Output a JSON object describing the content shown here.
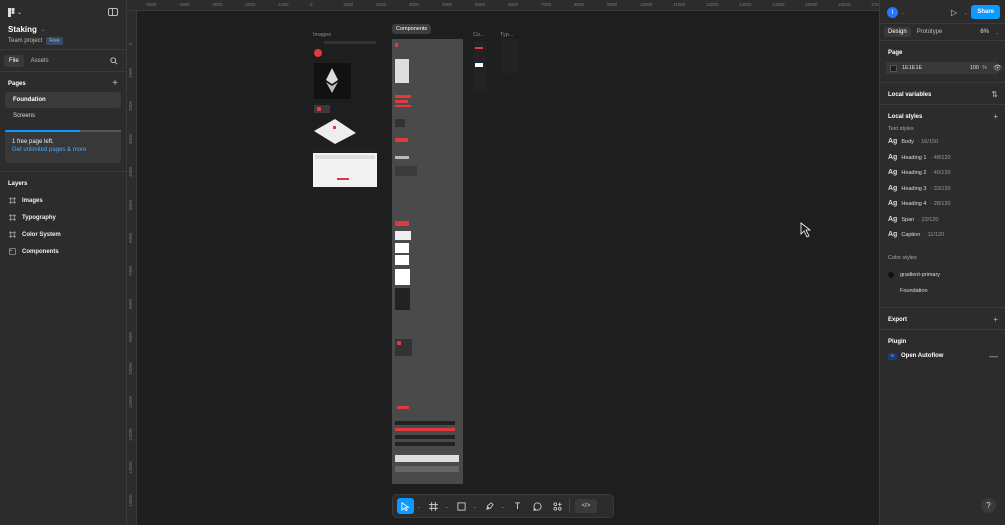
{
  "project": {
    "name": "Staking",
    "team": "Team project",
    "plan_badge": "Free"
  },
  "left_tabs": [
    "File",
    "Assets"
  ],
  "pages": {
    "title": "Pages",
    "items": [
      "Foundation",
      "Screens"
    ]
  },
  "promo": {
    "progress": 0.65,
    "line1": "1 free page left.",
    "line2": "Get unlimited pages & more"
  },
  "layers": {
    "title": "Layers",
    "items": [
      "Images",
      "Typography",
      "Color System",
      "Components"
    ]
  },
  "ruler_top": [
    "-5000",
    "-4000",
    "-3000",
    "-2000",
    "-1000",
    "0",
    "1000",
    "2000",
    "3000",
    "4000",
    "5000",
    "6000",
    "7000",
    "8000",
    "9000",
    "10000",
    "11000",
    "12000",
    "13000",
    "14000",
    "15000",
    "16000",
    "170"
  ],
  "ruler_left": [
    "0",
    "1000",
    "2000",
    "3000",
    "4000",
    "5000",
    "6000",
    "7000",
    "8000",
    "9000",
    "10000",
    "11000",
    "12000",
    "13000",
    "14000"
  ],
  "canvas_frames": {
    "images": "Images",
    "components": "Components",
    "co": "Co...",
    "typ": "Typ..."
  },
  "toolbar": {
    "icons": [
      "move-tool-icon",
      "frame-tool-icon",
      "rectangle-tool-icon",
      "pen-tool-icon",
      "text-tool-icon",
      "comment-tool-icon",
      "actions-icon",
      "dev-mode-icon"
    ],
    "text_glyph": "T",
    "code_glyph": "</>"
  },
  "right": {
    "avatar_letter": "I",
    "share_label": "Share",
    "tabs": [
      "Design",
      "Prototype"
    ],
    "zoom": "6%",
    "page": {
      "title": "Page",
      "hex": "1E1E1E",
      "opacity": "100",
      "pct": "%"
    },
    "local_variables": "Local variables",
    "local_styles": "Local styles",
    "text_styles_title": "Text styles",
    "text_styles": [
      {
        "ag": "Ag",
        "name": "Body",
        "meta": "· 16/150"
      },
      {
        "ag": "Ag",
        "name": "Heading 1",
        "meta": "· 48/120"
      },
      {
        "ag": "Ag",
        "name": "Heading 2",
        "meta": "· 40/120"
      },
      {
        "ag": "Ag",
        "name": "Heading 3",
        "meta": "· 33/120"
      },
      {
        "ag": "Ag",
        "name": "Heading 4",
        "meta": "· 28/120"
      },
      {
        "ag": "Ag",
        "name": "Span",
        "meta": "· 23/120"
      },
      {
        "ag": "Ag",
        "name": "Caption",
        "meta": "· 11/120"
      }
    ],
    "color_styles_title": "Color styles",
    "color_styles": [
      {
        "name": "gradient-primary",
        "color": "#111111"
      },
      {
        "name": "Foundation",
        "color": "#2c2c2c"
      }
    ],
    "export": "Export",
    "plugin_title": "Plugin",
    "plugin_name": "Open Autoflow",
    "help": "?"
  },
  "colors": {
    "accent": "#0d99ff",
    "panel": "#2c2c2c",
    "canvas": "#1e1e1e",
    "brand_red": "#e0393e"
  }
}
